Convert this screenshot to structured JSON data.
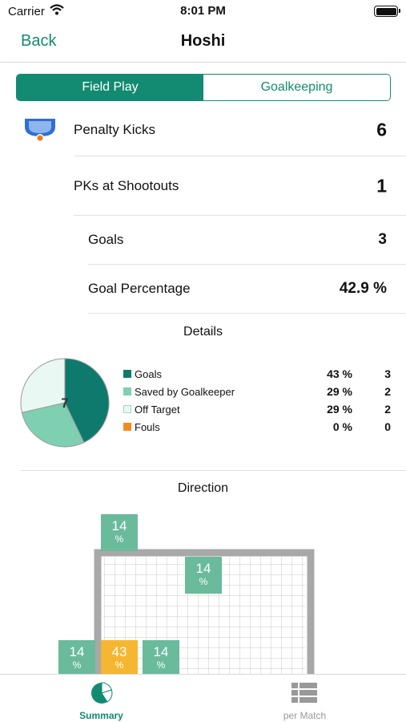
{
  "status_bar": {
    "carrier": "Carrier",
    "time": "8:01 PM"
  },
  "nav": {
    "back_label": "Back",
    "title": "Hoshi"
  },
  "segments": [
    {
      "label": "Field Play",
      "active": true
    },
    {
      "label": "Goalkeeping",
      "active": false
    }
  ],
  "stats": {
    "penalty_kicks": {
      "label": "Penalty Kicks",
      "value": "6"
    },
    "pks_at_shootouts": {
      "label": "PKs at Shootouts",
      "value": "1"
    },
    "goals": {
      "label": "Goals",
      "value": "3"
    },
    "goal_percentage": {
      "label": "Goal Percentage",
      "value": "42.9 %"
    }
  },
  "details": {
    "title": "Details",
    "pie_center": "7",
    "legend": [
      {
        "label": "Goals",
        "percent": "43 %",
        "count": "3",
        "color": "#0e7a6e"
      },
      {
        "label": "Saved by Goalkeeper",
        "percent": "29 %",
        "count": "2",
        "color": "#7fcfb3"
      },
      {
        "label": "Off Target",
        "percent": "29 %",
        "count": "2",
        "color": "#e9f8f2"
      },
      {
        "label": "Fouls",
        "percent": "0 %",
        "count": "0",
        "color": "#f5891f"
      }
    ]
  },
  "direction": {
    "title": "Direction",
    "zones": [
      {
        "value": "14",
        "unit": "%",
        "color": "#6aba9c"
      },
      {
        "value": "14",
        "unit": "%",
        "color": "#6aba9c"
      },
      {
        "value": "14",
        "unit": "%",
        "color": "#6aba9c"
      },
      {
        "value": "43",
        "unit": "%",
        "color": "#f5b731"
      },
      {
        "value": "14",
        "unit": "%",
        "color": "#6aba9c"
      }
    ]
  },
  "tabs": [
    {
      "label": "Summary",
      "icon": "pie-chart-icon",
      "active": true
    },
    {
      "label": "per Match",
      "icon": "list-icon",
      "active": false
    }
  ],
  "colors": {
    "accent": "#138a72",
    "goal_frame": "#a8a8a8"
  }
}
